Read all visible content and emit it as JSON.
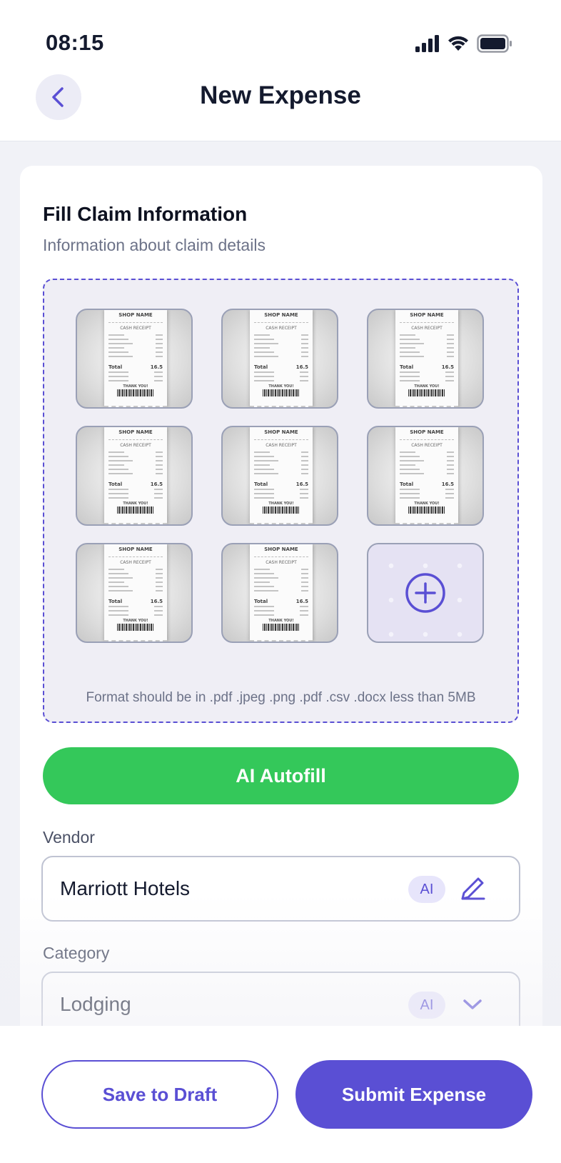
{
  "status_bar": {
    "time": "08:15",
    "icons": [
      "cellular-signal-icon",
      "wifi-icon",
      "battery-icon"
    ]
  },
  "header": {
    "title": "New Expense",
    "back_icon": "chevron-left-icon"
  },
  "form": {
    "title": "Fill Claim Information",
    "subtitle": "Information about claim details",
    "upload": {
      "receipts": [
        {
          "shop": "SHOP NAME",
          "heading": "CASH RECEIPT",
          "total_label": "Total",
          "total_value": "16.5",
          "footer": "THANK YOU!"
        },
        {
          "shop": "SHOP NAME",
          "heading": "CASH RECEIPT",
          "total_label": "Total",
          "total_value": "16.5",
          "footer": "THANK YOU!"
        },
        {
          "shop": "SHOP NAME",
          "heading": "CASH RECEIPT",
          "total_label": "Total",
          "total_value": "16.5",
          "footer": "THANK YOU!"
        },
        {
          "shop": "SHOP NAME",
          "heading": "CASH RECEIPT",
          "total_label": "Total",
          "total_value": "16.5",
          "footer": "THANK YOU!"
        },
        {
          "shop": "SHOP NAME",
          "heading": "CASH RECEIPT",
          "total_label": "Total",
          "total_value": "16.5",
          "footer": "THANK YOU!"
        },
        {
          "shop": "SHOP NAME",
          "heading": "CASH RECEIPT",
          "total_label": "Total",
          "total_value": "16.5",
          "footer": "THANK YOU!"
        },
        {
          "shop": "SHOP NAME",
          "heading": "CASH RECEIPT",
          "total_label": "Total",
          "total_value": "16.5",
          "footer": "THANK YOU!"
        },
        {
          "shop": "SHOP NAME",
          "heading": "CASH RECEIPT",
          "total_label": "Total",
          "total_value": "16.5",
          "footer": "THANK YOU!"
        }
      ],
      "add_icon": "plus-circle-icon",
      "format_note": "Format should be in .pdf .jpeg .png .pdf .csv .docx less than 5MB"
    },
    "ai_autofill_label": "AI Autofill",
    "vendor": {
      "label": "Vendor",
      "value": "Marriott Hotels",
      "badge": "AI",
      "action_icon": "pencil-icon"
    },
    "category": {
      "label": "Category",
      "value": "Lodging",
      "badge": "AI",
      "action_icon": "chevron-down-icon"
    }
  },
  "footer": {
    "draft_label": "Save to Draft",
    "submit_label": "Submit Expense"
  },
  "colors": {
    "accent": "#5a4fd4",
    "success": "#34c85a",
    "background": "#f1f2f7"
  }
}
